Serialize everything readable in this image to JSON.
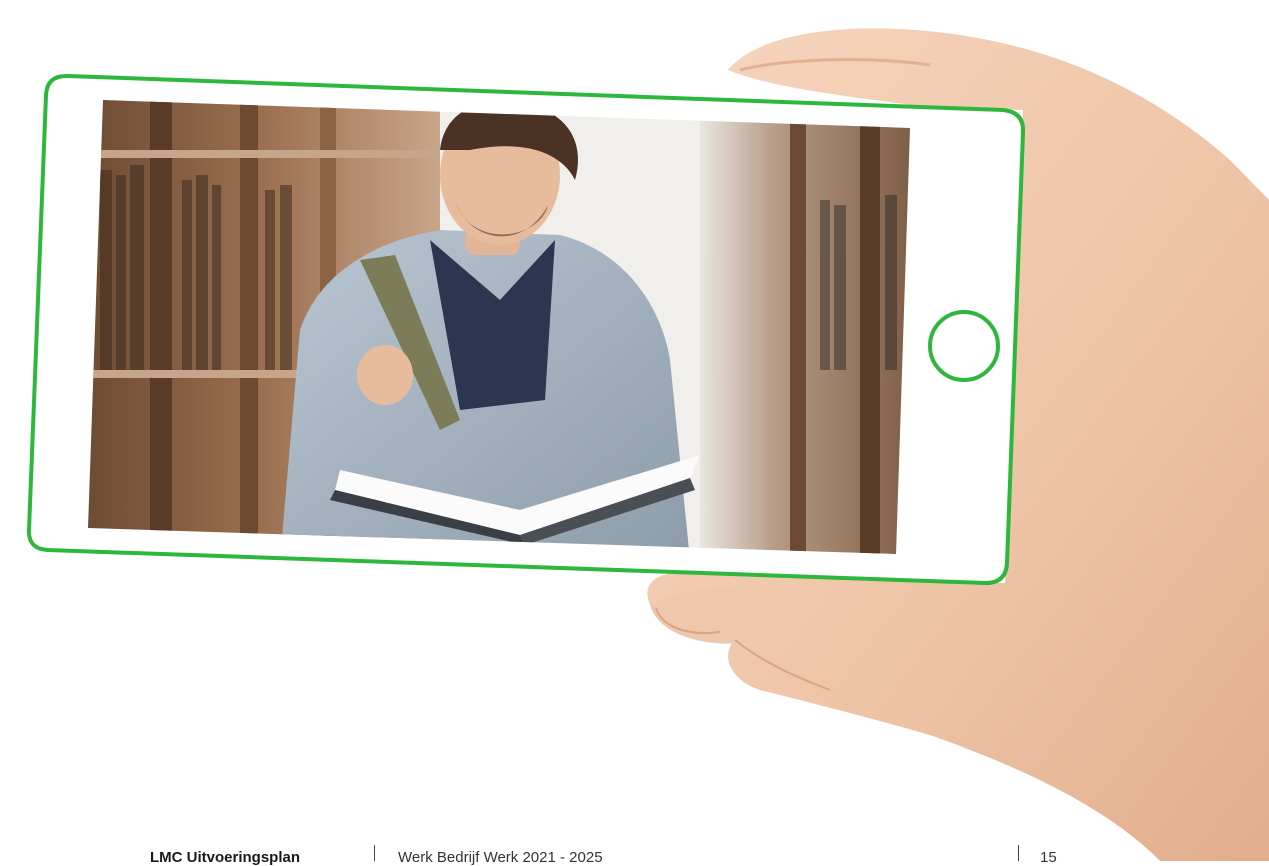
{
  "illustration": {
    "subject": "hand-holding-phone-with-student-reading-book-in-library",
    "accent_color": "#2db83d",
    "skin_color": "#f3cdb2",
    "home_button_icon": "circle-icon"
  },
  "footer": {
    "left_text": "LMC Uitvoeringsplan",
    "middle_text": "Werk Bedrijf Werk 2021 - 2025",
    "page_number": "15"
  }
}
